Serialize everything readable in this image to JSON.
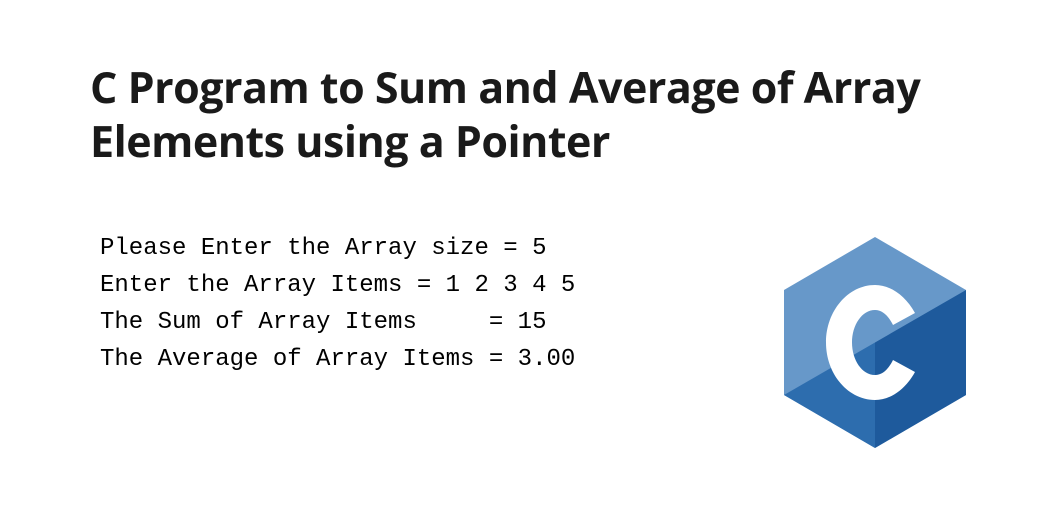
{
  "title": "C Program to Sum and Average of Array Elements using a Pointer",
  "code": {
    "line1": "Please Enter the Array size = 5",
    "line2": "Enter the Array Items = 1 2 3 4 5",
    "line3": "The Sum of Array Items     = 15",
    "line4": "The Average of Array Items = 3.00"
  },
  "logo": {
    "name": "c-language-logo",
    "letter": "C"
  }
}
